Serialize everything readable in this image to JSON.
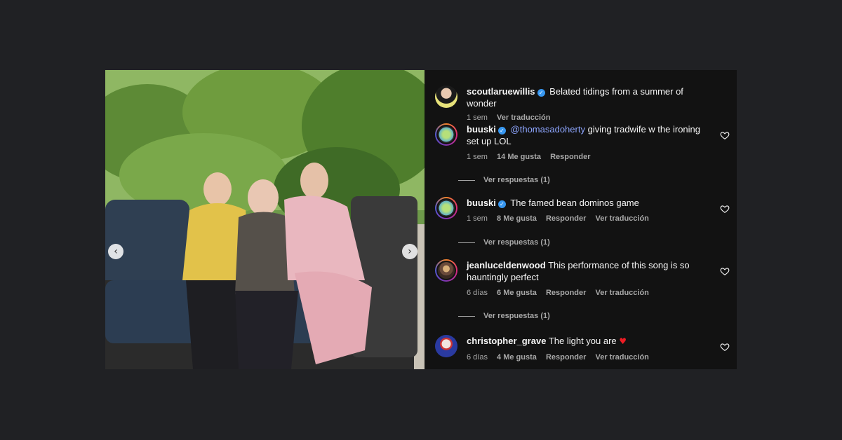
{
  "post": {
    "media": {
      "prev_icon": "chevron-left-icon",
      "next_icon": "chevron-right-icon",
      "prev_glyph": "‹",
      "next_glyph": "›"
    },
    "comments": [
      {
        "username": "scoutlaruewillis",
        "verified": true,
        "text": "Belated tidings from a summer of wonder",
        "time": "1 sem",
        "translate": "Ver traducción"
      },
      {
        "username": "buuski",
        "verified": true,
        "mention": "@thomasadoherty",
        "text": "giving tradwife w the ironing set up LOL",
        "time": "1 sem",
        "likes": "14 Me gusta",
        "reply": "Responder",
        "view_replies": "Ver respuestas (1)"
      },
      {
        "username": "buuski",
        "verified": true,
        "text": "The famed bean dominos game",
        "time": "1 sem",
        "likes": "8 Me gusta",
        "reply": "Responder",
        "translate": "Ver traducción",
        "view_replies": "Ver respuestas (1)"
      },
      {
        "username": "jeanluceldenwood",
        "text": "This performance of this song is so hauntingly perfect",
        "time": "6 días",
        "likes": "6 Me gusta",
        "reply": "Responder",
        "translate": "Ver traducción",
        "view_replies": "Ver respuestas (1)"
      },
      {
        "username": "christopher_grave",
        "text": "The light you are",
        "emoji": "♥",
        "time": "6 días",
        "likes": "4 Me gusta",
        "reply": "Responder",
        "translate": "Ver traducción"
      }
    ]
  },
  "colors": {
    "background": "#202124",
    "panel": "#121212",
    "mention": "#8ea6ff",
    "verified": "#3797f0",
    "heart": "#ed1c24"
  }
}
